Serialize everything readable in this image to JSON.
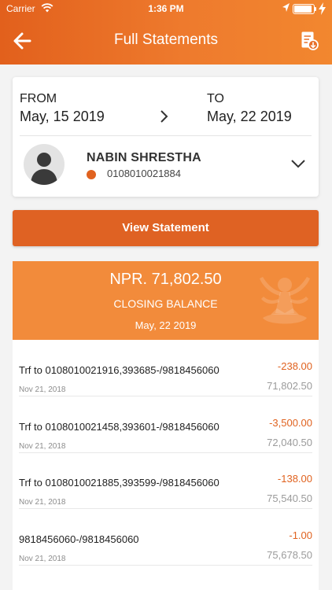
{
  "status_bar": {
    "carrier": "Carrier",
    "time": "1:36 PM",
    "battery_level": 1.0
  },
  "header": {
    "title": "Full Statements",
    "back_icon": "back-arrow-icon",
    "action_icon": "download-statement-icon",
    "colors": {
      "start": "#e2601c",
      "end": "#f2872f"
    }
  },
  "date_range": {
    "from_label": "FROM",
    "from_date": "May, 15 2019",
    "to_label": "TO",
    "to_date": "May, 22 2019"
  },
  "account": {
    "name": "NABIN SHRESTHA",
    "number": "0108010021884",
    "status_color": "#e0621f"
  },
  "view_button": {
    "label": "View Statement",
    "color": "#df6223"
  },
  "balance": {
    "amount": "NPR. 71,802.50",
    "label": "CLOSING BALANCE",
    "date": "May, 22 2019",
    "color": "#f28b3b"
  },
  "transactions": [
    {
      "description": "Trf to 0108010021916,393685-/9818456060",
      "date": "Nov 21, 2018",
      "amount": "-238.00",
      "balance": "71,802.50"
    },
    {
      "description": "Trf to 0108010021458,393601-/9818456060",
      "date": "Nov 21, 2018",
      "amount": "-3,500.00",
      "balance": "72,040.50"
    },
    {
      "description": "Trf to 0108010021885,393599-/9818456060",
      "date": "Nov 21, 2018",
      "amount": "-138.00",
      "balance": "75,540.50"
    },
    {
      "description": "9818456060-/9818456060",
      "date": "Nov 21, 2018",
      "amount": "-1.00",
      "balance": "75,678.50"
    }
  ]
}
